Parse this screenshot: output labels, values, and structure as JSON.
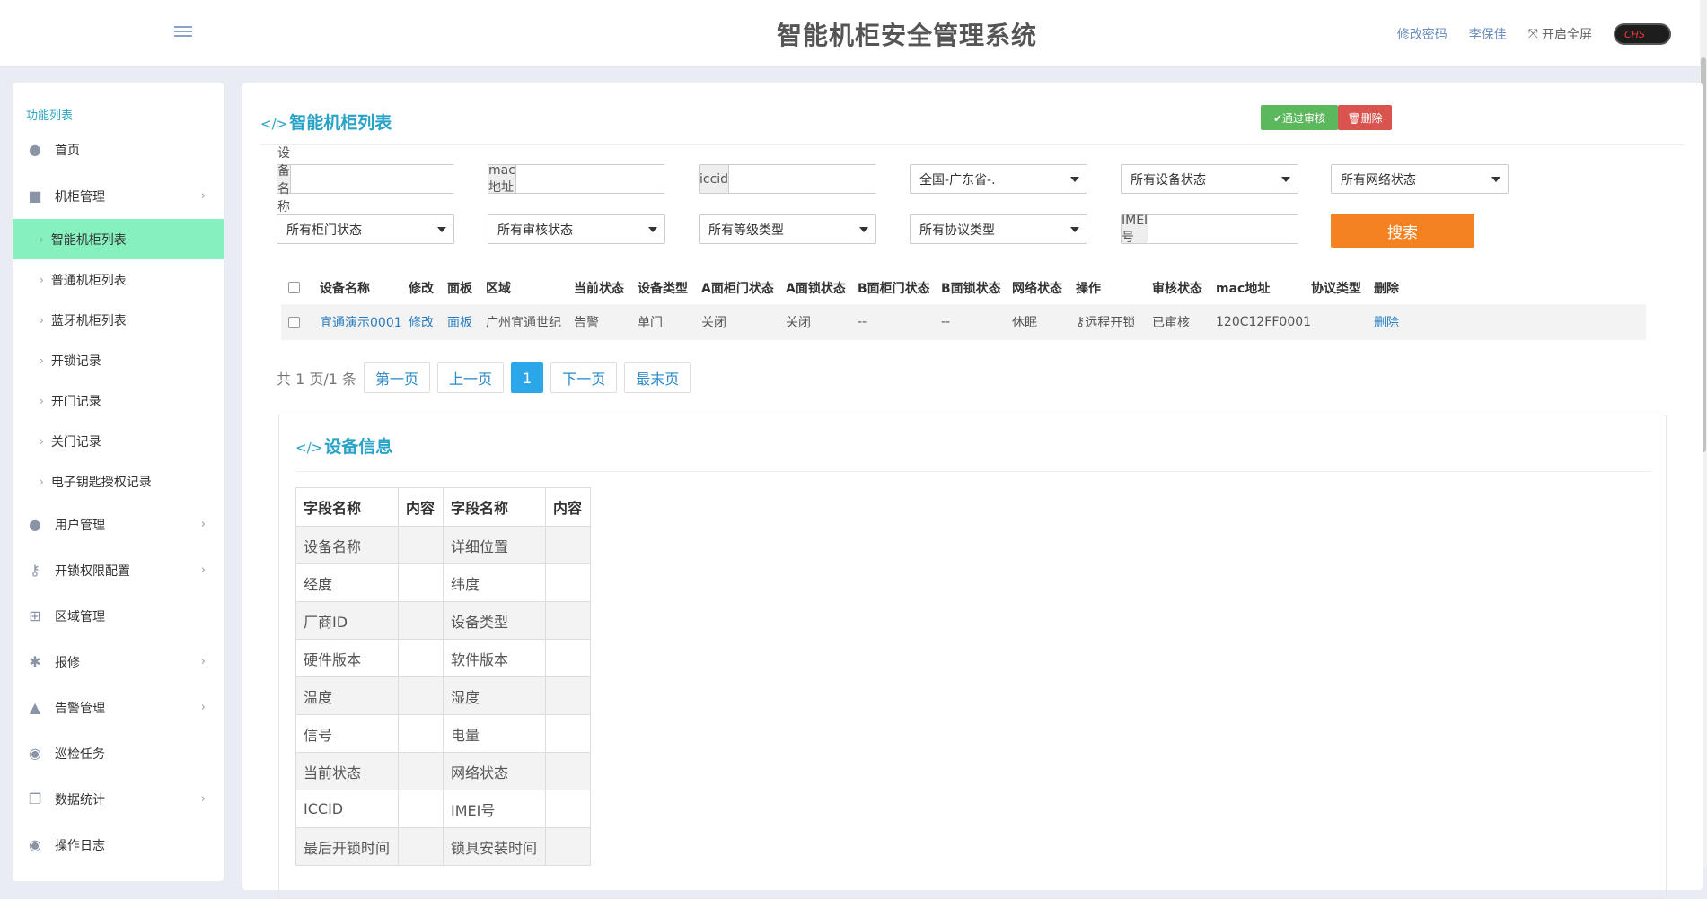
{
  "header": {
    "title": "智能机柜安全管理系统",
    "change_password": "修改密码",
    "user": "李保佳",
    "fullscreen": "开启全屏",
    "lang": "CHS"
  },
  "sidebar": {
    "heading": "功能列表",
    "items": [
      {
        "label": "首页",
        "icon": "user-icon"
      },
      {
        "label": "机柜管理",
        "icon": "lock-icon"
      },
      {
        "label": "用户管理",
        "icon": "user-icon"
      },
      {
        "label": "开锁权限配置",
        "icon": "key-icon"
      },
      {
        "label": "区域管理",
        "icon": "sitemap-icon"
      },
      {
        "label": "报修",
        "icon": "bug-icon"
      },
      {
        "label": "告警管理",
        "icon": "warning-icon"
      },
      {
        "label": "巡检任务",
        "icon": "eye-icon"
      },
      {
        "label": "数据统计",
        "icon": "copy-icon"
      },
      {
        "label": "操作日志",
        "icon": "eye-icon"
      }
    ],
    "sub_items": [
      "智能机柜列表",
      "普通机柜列表",
      "蓝牙机柜列表",
      "开锁记录",
      "开门记录",
      "关门记录",
      "电子钥匙授权记录"
    ]
  },
  "main": {
    "title": "智能机柜列表",
    "approve_btn": "通过审核",
    "delete_btn": "删除",
    "filters": {
      "device_name_label": "设备名称",
      "mac_label": "mac地址",
      "iccid_label": "iccid",
      "region": "全国-广东省-.",
      "device_status": "所有设备状态",
      "network_status": "所有网络状态",
      "door_status": "所有柜门状态",
      "audit_status": "所有审核状态",
      "level_type": "所有等级类型",
      "protocol_type": "所有协议类型",
      "imei_label": "IMEI号",
      "search_btn": "搜索"
    },
    "table": {
      "headers": [
        "设备名称",
        "修改",
        "面板",
        "区域",
        "当前状态",
        "设备类型",
        "A面柜门状态",
        "A面锁状态",
        "B面柜门状态",
        "B面锁状态",
        "网络状态",
        "操作",
        "审核状态",
        "mac地址",
        "协议类型",
        "删除"
      ],
      "rows": [
        [
          "宜通演示0001",
          "修改",
          "面板",
          "广州宜通世纪",
          "告警",
          "单门",
          "关闭",
          "关闭",
          "--",
          "--",
          "休眠",
          "远程开锁",
          "已审核",
          "120C12FF0001",
          "",
          "删除"
        ]
      ]
    },
    "pager": {
      "info": "共 1 页/1 条",
      "first": "第一页",
      "prev": "上一页",
      "current": "1",
      "next": "下一页",
      "last": "最末页"
    }
  },
  "device_info": {
    "title": "设备信息",
    "headers": [
      "字段名称",
      "内容",
      "字段名称",
      "内容"
    ],
    "rows": [
      [
        "设备名称",
        "",
        "详细位置",
        ""
      ],
      [
        "经度",
        "",
        "纬度",
        ""
      ],
      [
        "厂商ID",
        "",
        "设备类型",
        ""
      ],
      [
        "硬件版本",
        "",
        "软件版本",
        ""
      ],
      [
        "温度",
        "",
        "湿度",
        ""
      ],
      [
        "信号",
        "",
        "电量",
        ""
      ],
      [
        "当前状态",
        "",
        "网络状态",
        ""
      ],
      [
        "ICCID",
        "",
        "IMEI号",
        ""
      ],
      [
        "最后开锁时间",
        "",
        "锁具安装时间",
        ""
      ]
    ]
  }
}
